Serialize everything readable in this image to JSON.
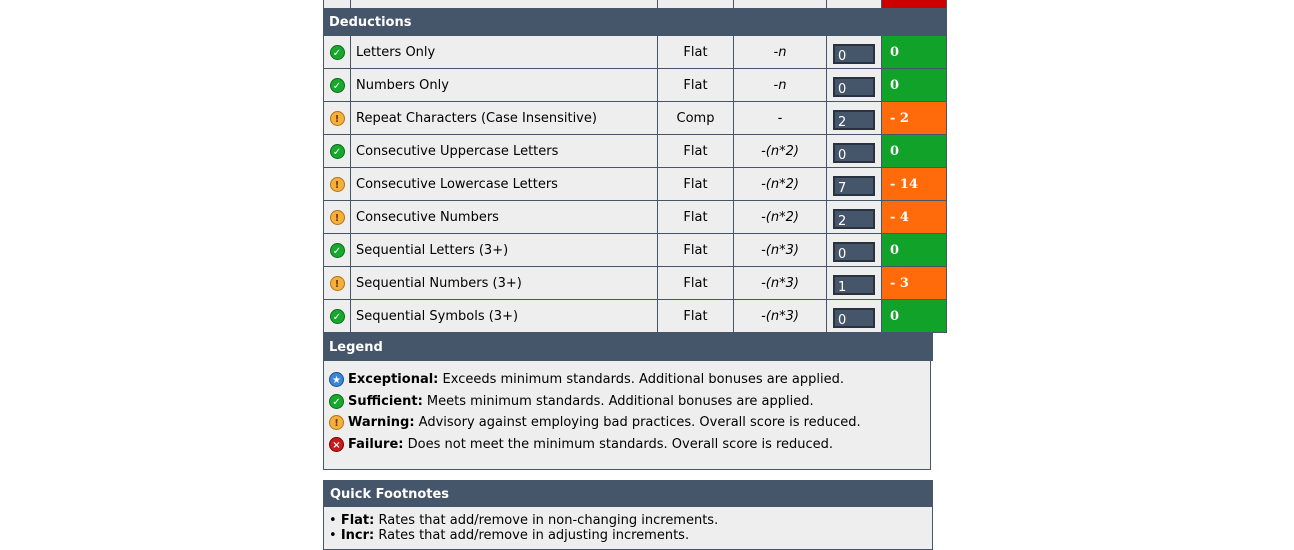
{
  "deductions": {
    "header": "Deductions",
    "rows": [
      {
        "label": "Letters Only",
        "type": "Flat",
        "rate": "-n",
        "count": "0",
        "bonus": "0",
        "status": "pass"
      },
      {
        "label": "Numbers Only",
        "type": "Flat",
        "rate": "-n",
        "count": "0",
        "bonus": "0",
        "status": "pass"
      },
      {
        "label": "Repeat Characters (Case Insensitive)",
        "type": "Comp",
        "rate": "-",
        "count": "2",
        "bonus": "- 2",
        "status": "warn"
      },
      {
        "label": "Consecutive Uppercase Letters",
        "type": "Flat",
        "rate": "-(n*2)",
        "count": "0",
        "bonus": "0",
        "status": "pass"
      },
      {
        "label": "Consecutive Lowercase Letters",
        "type": "Flat",
        "rate": "-(n*2)",
        "count": "7",
        "bonus": "- 14",
        "status": "warn"
      },
      {
        "label": "Consecutive Numbers",
        "type": "Flat",
        "rate": "-(n*2)",
        "count": "2",
        "bonus": "- 4",
        "status": "warn"
      },
      {
        "label": "Sequential Letters (3+)",
        "type": "Flat",
        "rate": "-(n*3)",
        "count": "0",
        "bonus": "0",
        "status": "pass"
      },
      {
        "label": "Sequential Numbers (3+)",
        "type": "Flat",
        "rate": "-(n*3)",
        "count": "1",
        "bonus": "- 3",
        "status": "warn"
      },
      {
        "label": "Sequential Symbols (3+)",
        "type": "Flat",
        "rate": "-(n*3)",
        "count": "0",
        "bonus": "0",
        "status": "pass"
      }
    ]
  },
  "legend": {
    "header": "Legend",
    "items": [
      {
        "term": "Exceptional:",
        "desc": " Exceeds minimum standards. Additional bonuses are applied.",
        "icon": "exceptional-icon"
      },
      {
        "term": "Sufficient:",
        "desc": " Meets minimum standards. Additional bonuses are applied.",
        "icon": "check-icon"
      },
      {
        "term": "Warning:",
        "desc": " Advisory against employing bad practices. Overall score is reduced.",
        "icon": "warning-icon"
      },
      {
        "term": "Failure:",
        "desc": " Does not meet the minimum standards. Overall score is reduced.",
        "icon": "failure-icon"
      }
    ]
  },
  "footnotes": {
    "header": "Quick Footnotes",
    "items": [
      {
        "term": "Flat:",
        "desc": " Rates that add/remove in non-changing increments."
      },
      {
        "term": "Incr:",
        "desc": " Rates that add/remove in adjusting increments."
      }
    ]
  },
  "colors": {
    "header": "#45556a",
    "pass": "#11a22a",
    "warn": "#ff6b0a",
    "fail": "#cc0000"
  }
}
